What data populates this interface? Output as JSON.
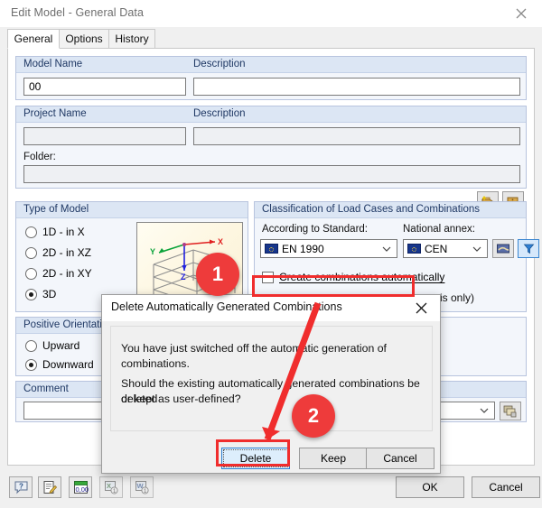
{
  "window": {
    "title": "Edit Model - General Data",
    "close_icon": "close-icon"
  },
  "tabs": [
    {
      "label": "General",
      "active": true
    },
    {
      "label": "Options",
      "active": false
    },
    {
      "label": "History",
      "active": false
    }
  ],
  "model_info": {
    "model_name_label": "Model Name",
    "model_name_value": "00",
    "description_label_1": "Description",
    "description_value_1": "",
    "project_name_label": "Project Name",
    "project_name_value": "",
    "description_label_2": "Description",
    "description_value_2": "",
    "folder_label": "Folder:",
    "folder_value": "",
    "new_folder_icon": "new-folder-icon",
    "browse_folder_icon": "browse-folder-icon"
  },
  "type_of_model": {
    "title": "Type of Model",
    "options": [
      {
        "label": "1D - in X",
        "accel": "1",
        "selected": false
      },
      {
        "label": "2D - in XZ",
        "accel": "2",
        "selected": false
      },
      {
        "label": "2D - in XY",
        "accel": "Y",
        "selected": false
      },
      {
        "label": "3D",
        "accel": "3",
        "selected": true
      }
    ],
    "preview_icon": "3d-frame-model-preview",
    "axis_labels": {
      "x": "X",
      "y": "Y",
      "z": "Z"
    }
  },
  "classification": {
    "title": "Classification of Load Cases and Combinations",
    "standard_label": "According to Standard:",
    "standard_value": "EN 1990",
    "annex_label": "National annex:",
    "annex_value": "CEN",
    "edit_annex_icon": "edit-annex-icon",
    "filter_icon": "filter-funnel-icon",
    "create_combinations_label": "Create combinations automatically",
    "create_combinations_checked": false,
    "hidden_option_tail": "is only)"
  },
  "positive_orientation": {
    "title": "Positive Orientation",
    "options": [
      {
        "label": "Upward",
        "accel": "U",
        "selected": false
      },
      {
        "label": "Downward",
        "accel": "D",
        "selected": true
      }
    ]
  },
  "comment": {
    "title": "Comment",
    "value": "",
    "library_icon": "comment-library-icon"
  },
  "footer": {
    "icons": [
      {
        "name": "help-icon"
      },
      {
        "name": "edit-notes-icon"
      },
      {
        "name": "units-decimal-icon"
      },
      {
        "name": "export-excel-icon"
      },
      {
        "name": "export-word-icon"
      }
    ],
    "ok_label": "OK",
    "cancel_label": "Cancel"
  },
  "dialog": {
    "title": "Delete Automatically Generated Combinations",
    "close_icon": "close-icon",
    "line1": "You have just switched off the automatic generation of combinations.",
    "line2": "Should the existing automatically generated combinations be deleted",
    "line3": "or kept as user-defined?",
    "buttons": [
      {
        "label": "Delete",
        "focused": true
      },
      {
        "label": "Keep",
        "focused": false
      },
      {
        "label": "Cancel",
        "focused": false
      }
    ]
  },
  "annotations": {
    "badge_1": "1",
    "badge_2": "2",
    "accent_color": "#ee3b3b"
  }
}
